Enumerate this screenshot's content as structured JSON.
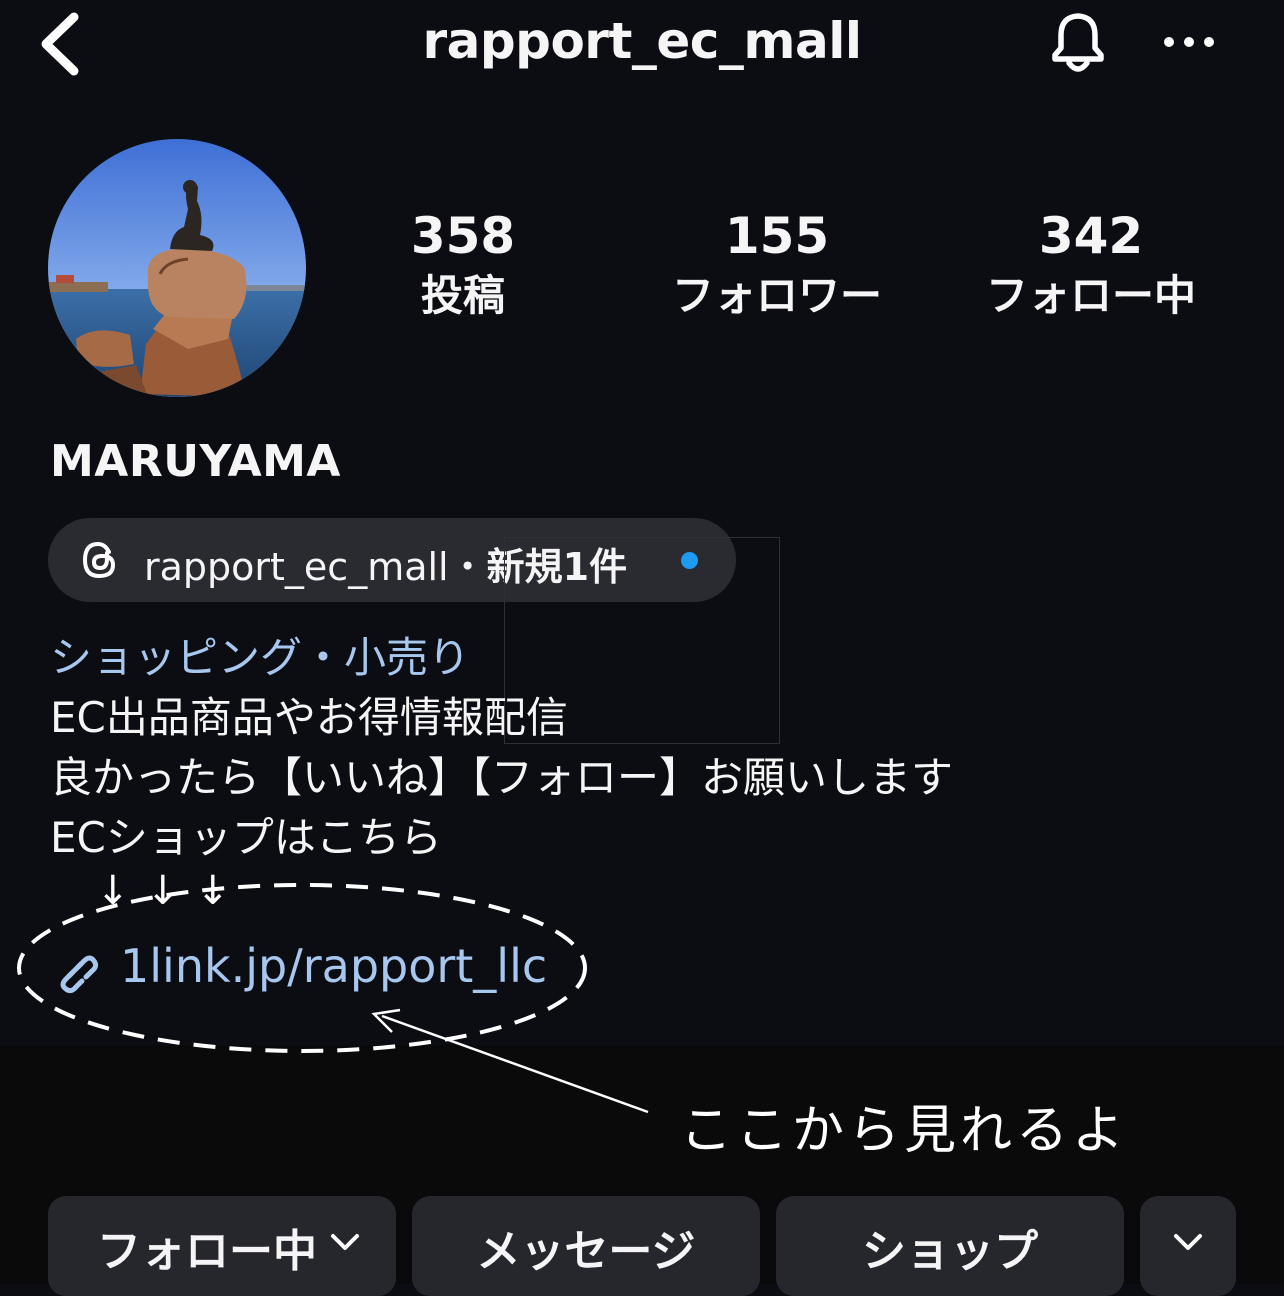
{
  "header": {
    "username": "rapport_ec_mall",
    "icons": {
      "back": "chevron-left-icon",
      "bell": "bell-icon",
      "more": "more-horizontal-icon"
    }
  },
  "profile": {
    "avatar": "profile-photo-little-mermaid",
    "stats": [
      {
        "value": "358",
        "label": "投稿"
      },
      {
        "value": "155",
        "label": "フォロワー"
      },
      {
        "value": "342",
        "label": "フォロー中"
      }
    ],
    "display_name": "MARUYAMA"
  },
  "threads": {
    "icon": "threads-icon",
    "handle": "rapport_ec_mall",
    "separator": "・",
    "badge": "新規1件",
    "dot_color": "#1d9bf0"
  },
  "bio": {
    "category": "ショッピング・小売り",
    "lines": [
      "EC出品商品やお得情報配信",
      "良かったら【いいね】【フォロー】お願いします",
      "ECショップはこちら"
    ]
  },
  "link": {
    "icon": "link-icon",
    "text": "1link.jp/rapport_llc"
  },
  "annotation": {
    "arrows": "↓",
    "text": "ここから見れるよ"
  },
  "actions": {
    "following": "フォロー中",
    "message": "メッセージ",
    "shop": "ショップ",
    "icons": {
      "following_chevron": "chevron-down-icon",
      "suggest": "chevron-down-icon"
    }
  },
  "colors": {
    "background": "#0c0d12",
    "link": "#a7c7ef",
    "button": "#26272c",
    "pill": "#2a2b31"
  }
}
